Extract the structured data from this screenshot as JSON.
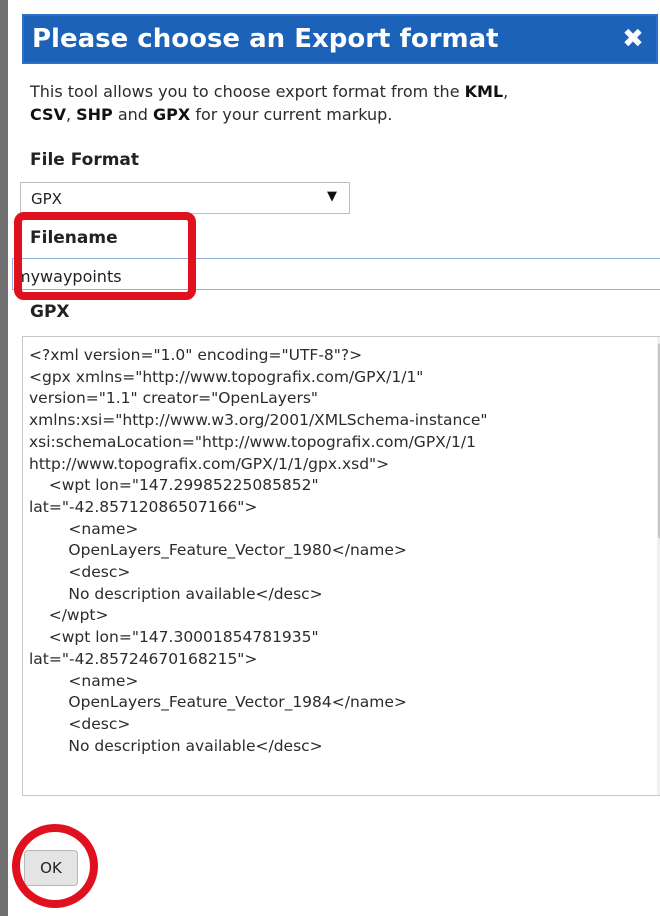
{
  "dialog": {
    "title": "Please choose an Export format",
    "close_icon": "✖",
    "description": {
      "part1": "This tool allows you to choose export format from the ",
      "kml": "KML",
      "comma1": ",",
      "csv": "CSV",
      "comma2": ", ",
      "shp": "SHP",
      "and": " and ",
      "gpx": "GPX",
      "part2": " for your current markup."
    },
    "file_format_label": "File Format",
    "file_format_value": "GPX",
    "dropdown_arrow": "▼",
    "filename_label": "Filename",
    "filename_value": "mywaypoints",
    "output_label": "GPX",
    "output_lines": [
      "<?xml version=\"1.0\" encoding=\"UTF-8\"?>",
      "<gpx xmlns=\"http://www.topografix.com/GPX/1/1\"",
      "version=\"1.1\" creator=\"OpenLayers\"",
      "xmlns:xsi=\"http://www.w3.org/2001/XMLSchema-instance\"",
      "xsi:schemaLocation=\"http://www.topografix.com/GPX/1/1",
      "http://www.topografix.com/GPX/1/1/gpx.xsd\">",
      "    <wpt lon=\"147.29985225085852\"",
      "lat=\"-42.85712086507166\">",
      "        <name>",
      "        OpenLayers_Feature_Vector_1980</name>",
      "        <desc>",
      "        No description available</desc>",
      "    </wpt>",
      "    <wpt lon=\"147.30001854781935\"",
      "lat=\"-42.85724670168215\">",
      "        <name>",
      "        OpenLayers_Feature_Vector_1984</name>",
      "        <desc>",
      "        No description available</desc>"
    ],
    "ok_label": "OK"
  },
  "colors": {
    "titlebar": "#1c62b8",
    "highlight": "#e0101e"
  }
}
